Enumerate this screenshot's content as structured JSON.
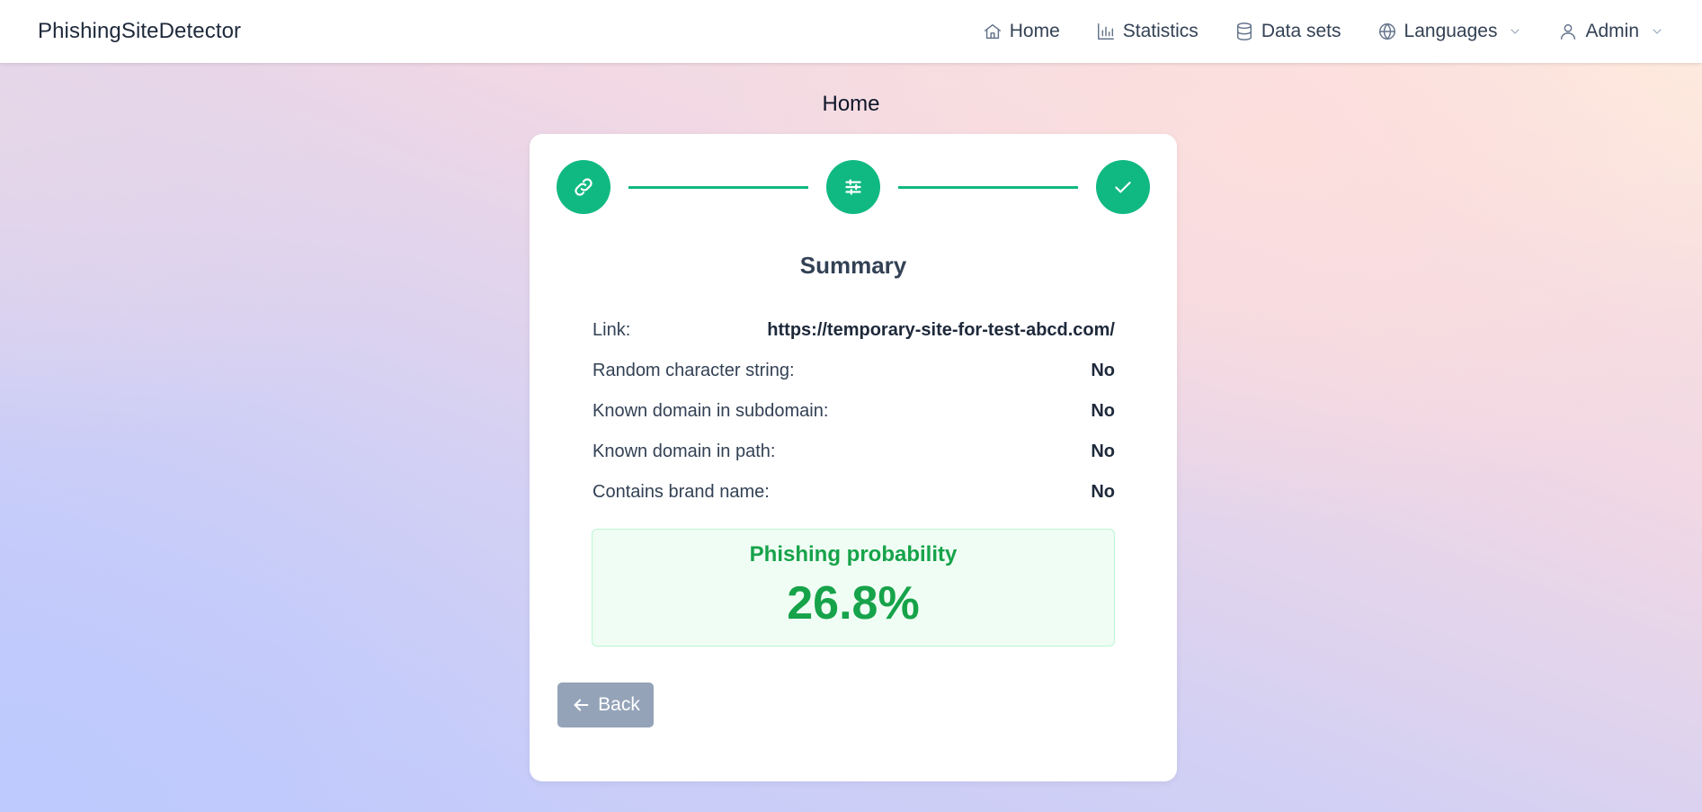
{
  "app": {
    "brand": "PhishingSiteDetector"
  },
  "nav": {
    "items": [
      {
        "label": "Home",
        "icon": "home-icon"
      },
      {
        "label": "Statistics",
        "icon": "bar-chart-icon"
      },
      {
        "label": "Data sets",
        "icon": "database-icon"
      },
      {
        "label": "Languages",
        "icon": "globe-icon",
        "dropdown": true
      },
      {
        "label": "Admin",
        "icon": "user-icon",
        "dropdown": true
      }
    ]
  },
  "page": {
    "title": "Home"
  },
  "stepper": {
    "steps": [
      {
        "icon": "link-icon",
        "state": "complete"
      },
      {
        "icon": "sliders-icon",
        "state": "complete"
      },
      {
        "icon": "check-icon",
        "state": "complete"
      }
    ],
    "accent": "#10b981"
  },
  "summary": {
    "title": "Summary",
    "rows": [
      {
        "label": "Link:",
        "value": "https://temporary-site-for-test-abcd.com/"
      },
      {
        "label": "Random character string:",
        "value": "No"
      },
      {
        "label": "Known domain in subdomain:",
        "value": "No"
      },
      {
        "label": "Known domain in path:",
        "value": "No"
      },
      {
        "label": "Contains brand name:",
        "value": "No"
      }
    ]
  },
  "result": {
    "label": "Phishing probability",
    "value": "26.8%",
    "color": "#16a34a"
  },
  "actions": {
    "back_label": "Back"
  }
}
